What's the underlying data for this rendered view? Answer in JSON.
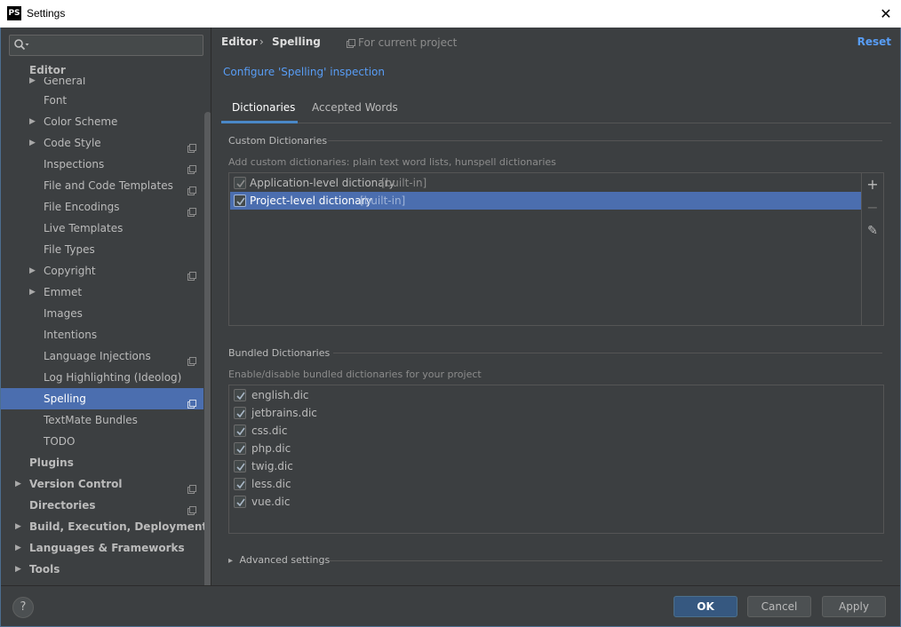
{
  "window": {
    "app_icon": "PS",
    "title": "Settings",
    "close_glyph": "✕"
  },
  "sidebar": {
    "search_placeholder": "",
    "items": [
      {
        "label": "Editor",
        "bold": true,
        "indent": 0,
        "arrow": "",
        "project": false,
        "selected": false
      },
      {
        "label": "General",
        "bold": false,
        "indent": 1,
        "arrow": "▶",
        "project": false,
        "selected": false
      },
      {
        "label": "Font",
        "bold": false,
        "indent": 1,
        "arrow": "",
        "project": false,
        "selected": false
      },
      {
        "label": "Color Scheme",
        "bold": false,
        "indent": 1,
        "arrow": "▶",
        "project": false,
        "selected": false
      },
      {
        "label": "Code Style",
        "bold": false,
        "indent": 1,
        "arrow": "▶",
        "project": true,
        "selected": false
      },
      {
        "label": "Inspections",
        "bold": false,
        "indent": 1,
        "arrow": "",
        "project": true,
        "selected": false
      },
      {
        "label": "File and Code Templates",
        "bold": false,
        "indent": 1,
        "arrow": "",
        "project": true,
        "selected": false
      },
      {
        "label": "File Encodings",
        "bold": false,
        "indent": 1,
        "arrow": "",
        "project": true,
        "selected": false
      },
      {
        "label": "Live Templates",
        "bold": false,
        "indent": 1,
        "arrow": "",
        "project": false,
        "selected": false
      },
      {
        "label": "File Types",
        "bold": false,
        "indent": 1,
        "arrow": "",
        "project": false,
        "selected": false
      },
      {
        "label": "Copyright",
        "bold": false,
        "indent": 1,
        "arrow": "▶",
        "project": true,
        "selected": false
      },
      {
        "label": "Emmet",
        "bold": false,
        "indent": 1,
        "arrow": "▶",
        "project": false,
        "selected": false
      },
      {
        "label": "Images",
        "bold": false,
        "indent": 1,
        "arrow": "",
        "project": false,
        "selected": false
      },
      {
        "label": "Intentions",
        "bold": false,
        "indent": 1,
        "arrow": "",
        "project": false,
        "selected": false
      },
      {
        "label": "Language Injections",
        "bold": false,
        "indent": 1,
        "arrow": "",
        "project": true,
        "selected": false
      },
      {
        "label": "Log Highlighting (Ideolog)",
        "bold": false,
        "indent": 1,
        "arrow": "",
        "project": false,
        "selected": false
      },
      {
        "label": "Spelling",
        "bold": false,
        "indent": 1,
        "arrow": "",
        "project": true,
        "selected": true
      },
      {
        "label": "TextMate Bundles",
        "bold": false,
        "indent": 1,
        "arrow": "",
        "project": false,
        "selected": false
      },
      {
        "label": "TODO",
        "bold": false,
        "indent": 1,
        "arrow": "",
        "project": false,
        "selected": false
      },
      {
        "label": "Plugins",
        "bold": true,
        "indent": 0,
        "arrow": "",
        "project": false,
        "selected": false
      },
      {
        "label": "Version Control",
        "bold": true,
        "indent": 0,
        "arrow": "▶",
        "project": true,
        "selected": false
      },
      {
        "label": "Directories",
        "bold": true,
        "indent": 0,
        "arrow": "",
        "project": true,
        "selected": false
      },
      {
        "label": "Build, Execution, Deployment",
        "bold": true,
        "indent": 0,
        "arrow": "▶",
        "project": false,
        "selected": false
      },
      {
        "label": "Languages & Frameworks",
        "bold": true,
        "indent": 0,
        "arrow": "▶",
        "project": false,
        "selected": false
      },
      {
        "label": "Tools",
        "bold": true,
        "indent": 0,
        "arrow": "▶",
        "project": false,
        "selected": false
      }
    ]
  },
  "header": {
    "breadcrumb_parent": "Editor",
    "breadcrumb_sep": "›",
    "breadcrumb_current": "Spelling",
    "scope_label": "For current project",
    "reset_label": "Reset"
  },
  "configure_link": "Configure 'Spelling' inspection",
  "tabs": [
    {
      "label": "Dictionaries",
      "active": true
    },
    {
      "label": "Accepted Words",
      "active": false
    }
  ],
  "custom": {
    "title": "Custom Dictionaries",
    "hint": "Add custom dictionaries: plain text word lists, hunspell dictionaries",
    "rows": [
      {
        "name": "Application-level dictionary",
        "tag": "[built-in]",
        "checked": true,
        "selected": false
      },
      {
        "name": "Project-level dictionary",
        "tag": "[built-in]",
        "checked": true,
        "selected": true
      }
    ],
    "add_glyph": "+",
    "remove_glyph": "−",
    "edit_glyph": "✎"
  },
  "bundled": {
    "title": "Bundled Dictionaries",
    "hint": "Enable/disable bundled dictionaries for your project",
    "rows": [
      {
        "name": "english.dic",
        "checked": true
      },
      {
        "name": "jetbrains.dic",
        "checked": true
      },
      {
        "name": "css.dic",
        "checked": true
      },
      {
        "name": "php.dic",
        "checked": true
      },
      {
        "name": "twig.dic",
        "checked": true
      },
      {
        "name": "less.dic",
        "checked": true
      },
      {
        "name": "vue.dic",
        "checked": true
      }
    ]
  },
  "advanced": {
    "arrow": "▸",
    "label": "Advanced settings"
  },
  "footer": {
    "help_glyph": "?",
    "ok_label": "OK",
    "cancel_label": "Cancel",
    "apply_label": "Apply"
  },
  "colors": {
    "background": "#3c3f41",
    "selection": "#4b6eaf",
    "link": "#589df6",
    "primary_button": "#365880"
  }
}
